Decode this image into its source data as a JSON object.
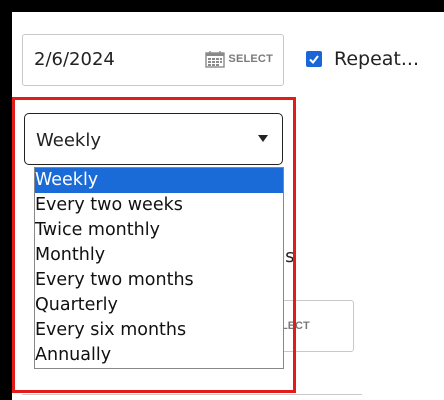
{
  "date": {
    "value": "2/6/2024",
    "select_label": "SELECT"
  },
  "repeat": {
    "label": "Repeat...",
    "checked": true
  },
  "background": {
    "partial_text": "es",
    "select_partial": "LECT"
  },
  "frequency": {
    "current": "Weekly",
    "options": [
      "Weekly",
      "Every two weeks",
      "Twice monthly",
      "Monthly",
      "Every two months",
      "Quarterly",
      "Every six months",
      "Annually"
    ],
    "selected_index": 0
  },
  "colors": {
    "accent": "#1a6ad8",
    "highlight_border": "#e31b1b"
  }
}
